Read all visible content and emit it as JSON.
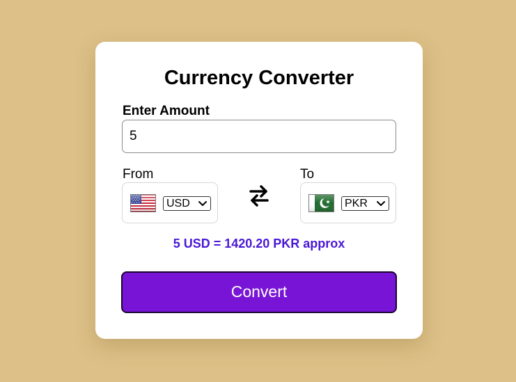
{
  "app": {
    "title": "Currency Converter",
    "accent_color": "#7814d6",
    "background_color": "#dcc087",
    "result_color": "#4a17d6"
  },
  "amount": {
    "label": "Enter Amount",
    "value": "5"
  },
  "from": {
    "label": "From",
    "currency": "USD",
    "flag": "us-flag-icon"
  },
  "to": {
    "label": "To",
    "currency": "PKR",
    "flag": "pk-flag-icon"
  },
  "swap": {
    "icon": "swap-arrows-icon"
  },
  "result": {
    "text": "5 USD = 1420.20 PKR approx"
  },
  "convert": {
    "label": "Convert"
  }
}
